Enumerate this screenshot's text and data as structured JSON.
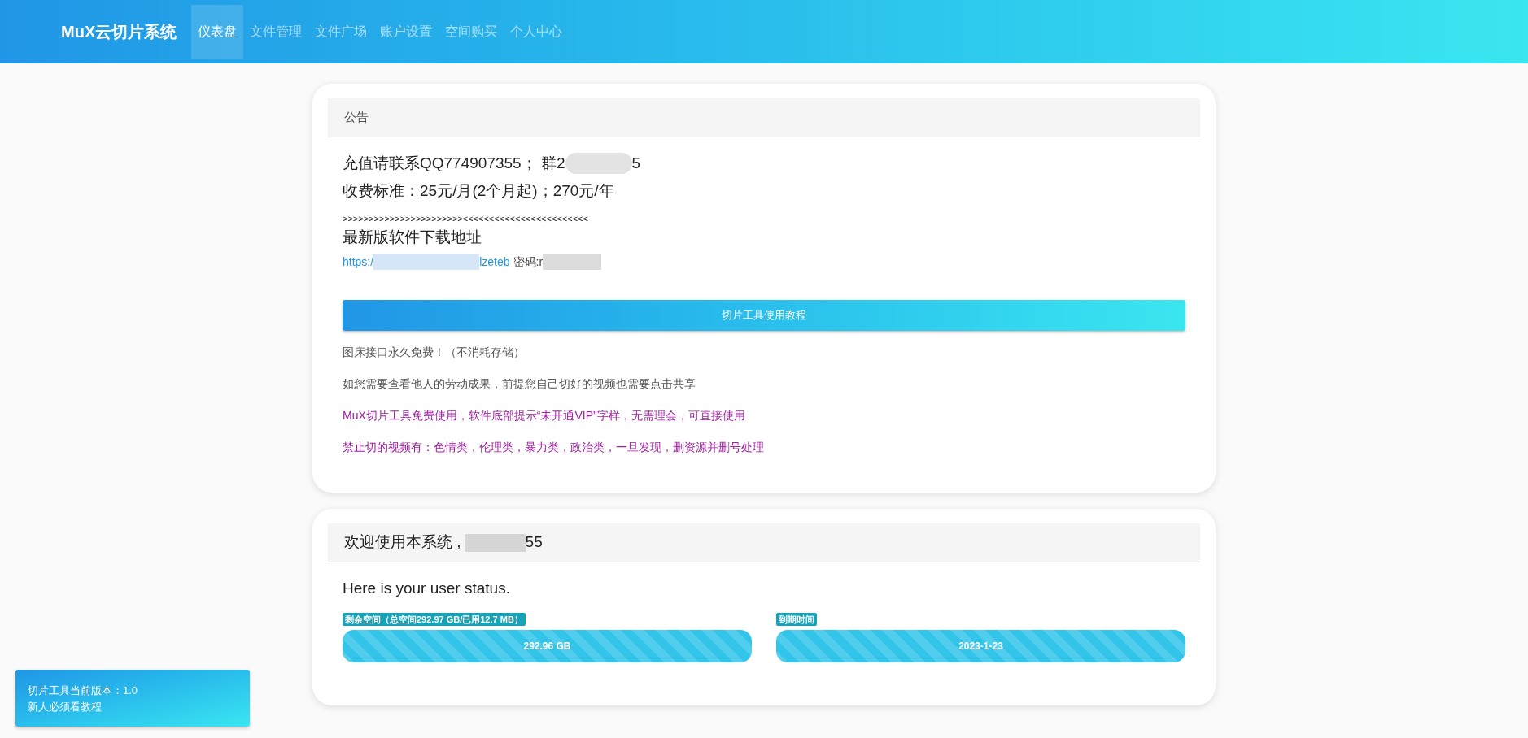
{
  "navbar": {
    "brand": "MuX云切片系统",
    "items": [
      {
        "label": "仪表盘",
        "selected": true
      },
      {
        "label": "文件管理",
        "selected": false
      },
      {
        "label": "文件广场",
        "selected": false
      },
      {
        "label": "账户设置",
        "selected": false
      },
      {
        "label": "空间购买",
        "selected": false
      },
      {
        "label": "个人中心",
        "selected": false
      }
    ]
  },
  "notice_card": {
    "title": "公告",
    "contact_line": {
      "before": "充值请联系QQ774907355； 群2",
      "after": "5"
    },
    "price_line": "收费标准：25元/月(2个月起)；270元/年",
    "separator_line": ">>>>>>>>>>>>>>>>>>>>>>><<<<<<<<<<<<<<<<<<<<<<<<",
    "download_title": "最新版软件下载地址",
    "download_link": {
      "before": "https:/",
      "after": "lzeteb"
    },
    "password_label": "密码:r",
    "tutorial_button": "切片工具使用教程",
    "notes": [
      {
        "text": "图床接口永久免费！（不消耗存储）",
        "kind": "plain"
      },
      {
        "text": "如您需要查看他人的劳动成果，前提您自己切好的视频也需要点击共享",
        "kind": "plain"
      },
      {
        "text": "MuX切片工具免费使用，软件底部提示“未开通VIP”字样，无需理会，可直接使用",
        "kind": "warning"
      },
      {
        "text": "禁止切的视频有：色情类，伦理类，暴力类，政治类，一旦发现，删资源并删号处理",
        "kind": "warning"
      }
    ]
  },
  "status_card": {
    "title_before": "欢迎使用本系统 ,",
    "title_after": "55",
    "subtitle": "Here is your user status.",
    "meters": [
      {
        "label": "剩余空间（总空间292.97 GB/已用12.7 MB）",
        "reading": "292.96 GB",
        "level": 1
      },
      {
        "label": "到期时间",
        "reading": "2023-1-23",
        "level": 1
      }
    ]
  },
  "toast": {
    "version_line": "切片工具当前版本：1.0",
    "hint": "新人必须看教程"
  }
}
